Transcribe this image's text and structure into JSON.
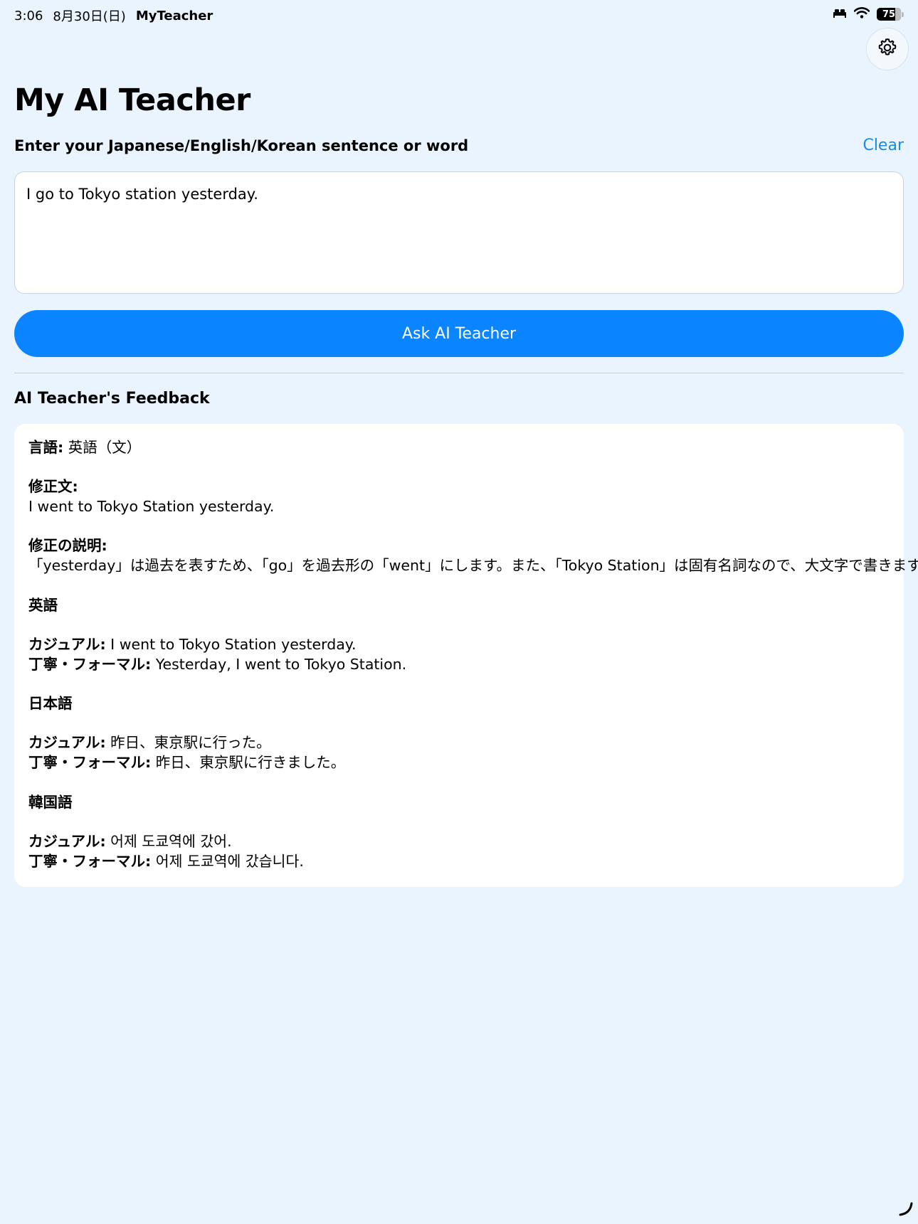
{
  "status_bar": {
    "time": "3:06",
    "date": "8月30日(日)",
    "app_name": "MyTeacher",
    "battery": "75"
  },
  "header": {
    "title": "My AI Teacher"
  },
  "input": {
    "label": "Enter your Japanese/English/Korean sentence or word",
    "clear_label": "Clear",
    "value": "I go to Tokyo station yesterday."
  },
  "actions": {
    "ask_label": "Ask AI Teacher"
  },
  "feedback": {
    "heading": "AI Teacher's Feedback",
    "language_label": "言語:",
    "language_value": " 英語（文）",
    "corrected_label": "修正文:",
    "corrected_value": "I went to Tokyo Station yesterday.",
    "explanation_label": "修正の説明:",
    "explanation_value": "「yesterday」は過去を表すため、「go」を過去形の「went」にします。また、「Tokyo Station」は固有名詞なので、大文字で書きます。",
    "sections": [
      {
        "title": "英語",
        "casual_label": "カジュアル:",
        "casual_value": " I went to Tokyo Station yesterday.",
        "formal_label": "丁寧・フォーマル:",
        "formal_value": " Yesterday, I went to Tokyo Station."
      },
      {
        "title": "日本語",
        "casual_label": "カジュアル:",
        "casual_value": " 昨日、東京駅に行った。",
        "formal_label": "丁寧・フォーマル:",
        "formal_value": " 昨日、東京駅に行きました。"
      },
      {
        "title": "韓国語",
        "casual_label": "カジュアル:",
        "casual_value": " 어제 도쿄역에 갔어.",
        "formal_label": "丁寧・フォーマル:",
        "formal_value": " 어제 도쿄역에 갔습니다."
      }
    ]
  },
  "colors": {
    "background": "#EAF4FE",
    "accent": "#0A84FF",
    "link": "#1E88E5"
  }
}
